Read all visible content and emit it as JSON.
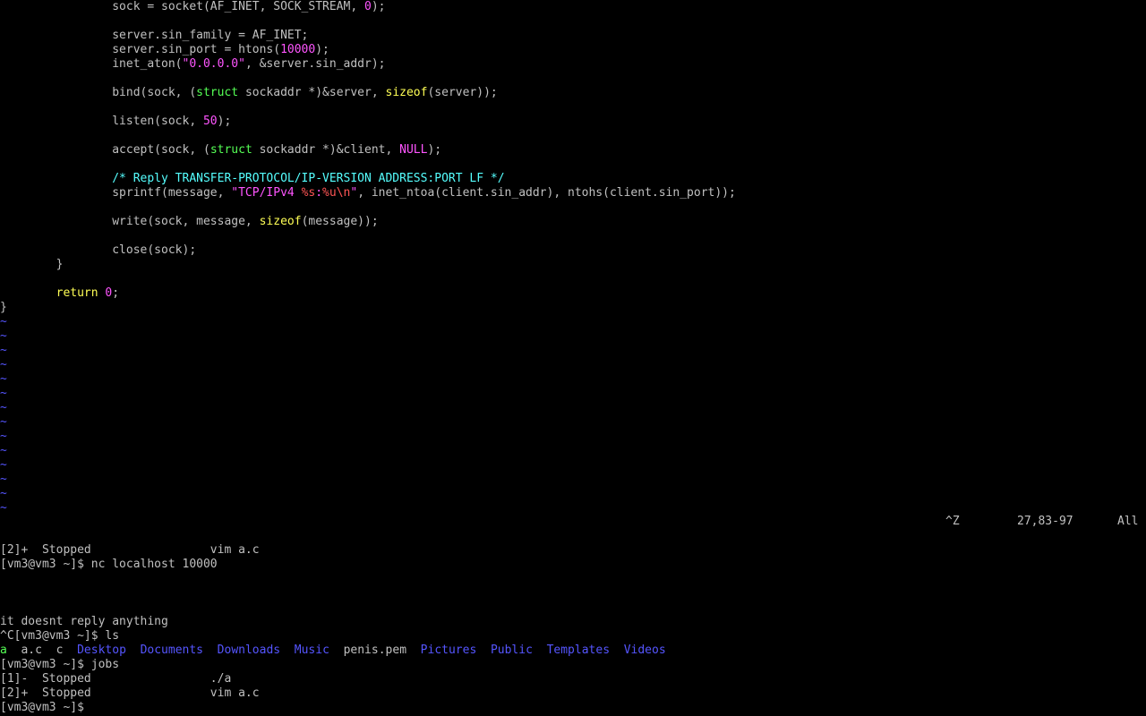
{
  "colors": {
    "background": "#000000",
    "default_text": "#c0c0c0",
    "type_green": "#55ff55",
    "keyword_yellow": "#ffff55",
    "constant_magenta": "#ff55ff",
    "special_red": "#ff5555",
    "comment_cyan": "#55ffff",
    "tilde_blue": "#5555ff",
    "directory_blue": "#5555ff"
  },
  "vim": {
    "code_lines": [
      [
        {
          "t": "                sock = socket(AF_INET, SOCK_STREAM, ",
          "c": "default"
        },
        {
          "t": "0",
          "c": "number"
        },
        {
          "t": ");",
          "c": "default"
        }
      ],
      [
        {
          "t": "",
          "c": "default"
        }
      ],
      [
        {
          "t": "                server.sin_family = AF_INET;",
          "c": "default"
        }
      ],
      [
        {
          "t": "                server.sin_port = htons(",
          "c": "default"
        },
        {
          "t": "10000",
          "c": "number"
        },
        {
          "t": ");",
          "c": "default"
        }
      ],
      [
        {
          "t": "                inet_aton(",
          "c": "default"
        },
        {
          "t": "\"0.0.0.0\"",
          "c": "string"
        },
        {
          "t": ", &server.sin_addr);",
          "c": "default"
        }
      ],
      [
        {
          "t": "",
          "c": "default"
        }
      ],
      [
        {
          "t": "                bind(sock, (",
          "c": "default"
        },
        {
          "t": "struct",
          "c": "type"
        },
        {
          "t": " sockaddr *)&server, ",
          "c": "default"
        },
        {
          "t": "sizeof",
          "c": "keyword"
        },
        {
          "t": "(server));",
          "c": "default"
        }
      ],
      [
        {
          "t": "",
          "c": "default"
        }
      ],
      [
        {
          "t": "                listen(sock, ",
          "c": "default"
        },
        {
          "t": "50",
          "c": "number"
        },
        {
          "t": ");",
          "c": "default"
        }
      ],
      [
        {
          "t": "",
          "c": "default"
        }
      ],
      [
        {
          "t": "                accept(sock, (",
          "c": "default"
        },
        {
          "t": "struct",
          "c": "type"
        },
        {
          "t": " sockaddr *)&client, ",
          "c": "default"
        },
        {
          "t": "NULL",
          "c": "number"
        },
        {
          "t": ");",
          "c": "default"
        }
      ],
      [
        {
          "t": "",
          "c": "default"
        }
      ],
      [
        {
          "t": "                /* Reply TRANSFER-PROTOCOL/IP-VERSION ADDRESS:PORT LF */",
          "c": "comment"
        }
      ],
      [
        {
          "t": "                sprintf(message, ",
          "c": "default"
        },
        {
          "t": "\"TCP/IPv4 ",
          "c": "string"
        },
        {
          "t": "%s",
          "c": "special"
        },
        {
          "t": ":",
          "c": "string"
        },
        {
          "t": "%u\\n",
          "c": "special"
        },
        {
          "t": "\"",
          "c": "string"
        },
        {
          "t": ", inet_ntoa(client.sin_addr), ntohs(client.sin_port));",
          "c": "default"
        }
      ],
      [
        {
          "t": "",
          "c": "default"
        }
      ],
      [
        {
          "t": "                write(sock, message, ",
          "c": "default"
        },
        {
          "t": "sizeof",
          "c": "keyword"
        },
        {
          "t": "(message));",
          "c": "default"
        }
      ],
      [
        {
          "t": "",
          "c": "default"
        }
      ],
      [
        {
          "t": "                close(sock);",
          "c": "default"
        }
      ],
      [
        {
          "t": "        }",
          "c": "default"
        }
      ],
      [
        {
          "t": "",
          "c": "default"
        }
      ],
      [
        {
          "t": "        ",
          "c": "default"
        },
        {
          "t": "return",
          "c": "keyword"
        },
        {
          "t": " ",
          "c": "default"
        },
        {
          "t": "0",
          "c": "number"
        },
        {
          "t": ";",
          "c": "default"
        }
      ],
      [
        {
          "t": "}",
          "c": "default"
        }
      ]
    ],
    "tilde_lines": [
      "~",
      "~",
      "~",
      "~",
      "~",
      "~",
      "~",
      "~",
      "~",
      "~",
      "~",
      "~",
      "~",
      "~"
    ],
    "status": {
      "cmd": "^Z",
      "position": "27,83-97",
      "scroll": "All"
    }
  },
  "shell": {
    "lines": [
      [
        {
          "t": "[2]+  Stopped                 vim a.c",
          "c": "default"
        }
      ],
      [
        {
          "t": "[vm3@vm3 ~]$ nc localhost 10000",
          "c": "default"
        }
      ],
      [
        {
          "t": "",
          "c": "default"
        }
      ],
      [
        {
          "t": "",
          "c": "default"
        }
      ],
      [
        {
          "t": "",
          "c": "default"
        }
      ],
      [
        {
          "t": "it doesnt reply anything",
          "c": "default"
        }
      ],
      [
        {
          "t": "^C[vm3@vm3 ~]$ ls",
          "c": "default"
        }
      ],
      [
        {
          "t": "a",
          "c": "exec"
        },
        {
          "t": "  a.c  c  ",
          "c": "default"
        },
        {
          "t": "Desktop",
          "c": "dir"
        },
        {
          "t": "  ",
          "c": "default"
        },
        {
          "t": "Documents",
          "c": "dir"
        },
        {
          "t": "  ",
          "c": "default"
        },
        {
          "t": "Downloads",
          "c": "dir"
        },
        {
          "t": "  ",
          "c": "default"
        },
        {
          "t": "Music",
          "c": "dir"
        },
        {
          "t": "  penis.pem  ",
          "c": "default"
        },
        {
          "t": "Pictures",
          "c": "dir"
        },
        {
          "t": "  ",
          "c": "default"
        },
        {
          "t": "Public",
          "c": "dir"
        },
        {
          "t": "  ",
          "c": "default"
        },
        {
          "t": "Templates",
          "c": "dir"
        },
        {
          "t": "  ",
          "c": "default"
        },
        {
          "t": "Videos",
          "c": "dir"
        }
      ],
      [
        {
          "t": "[vm3@vm3 ~]$ jobs",
          "c": "default"
        }
      ],
      [
        {
          "t": "[1]-  Stopped                 ./a",
          "c": "default"
        }
      ],
      [
        {
          "t": "[2]+  Stopped                 vim a.c",
          "c": "default"
        }
      ],
      [
        {
          "t": "[vm3@vm3 ~]$ ",
          "c": "default"
        }
      ]
    ]
  }
}
